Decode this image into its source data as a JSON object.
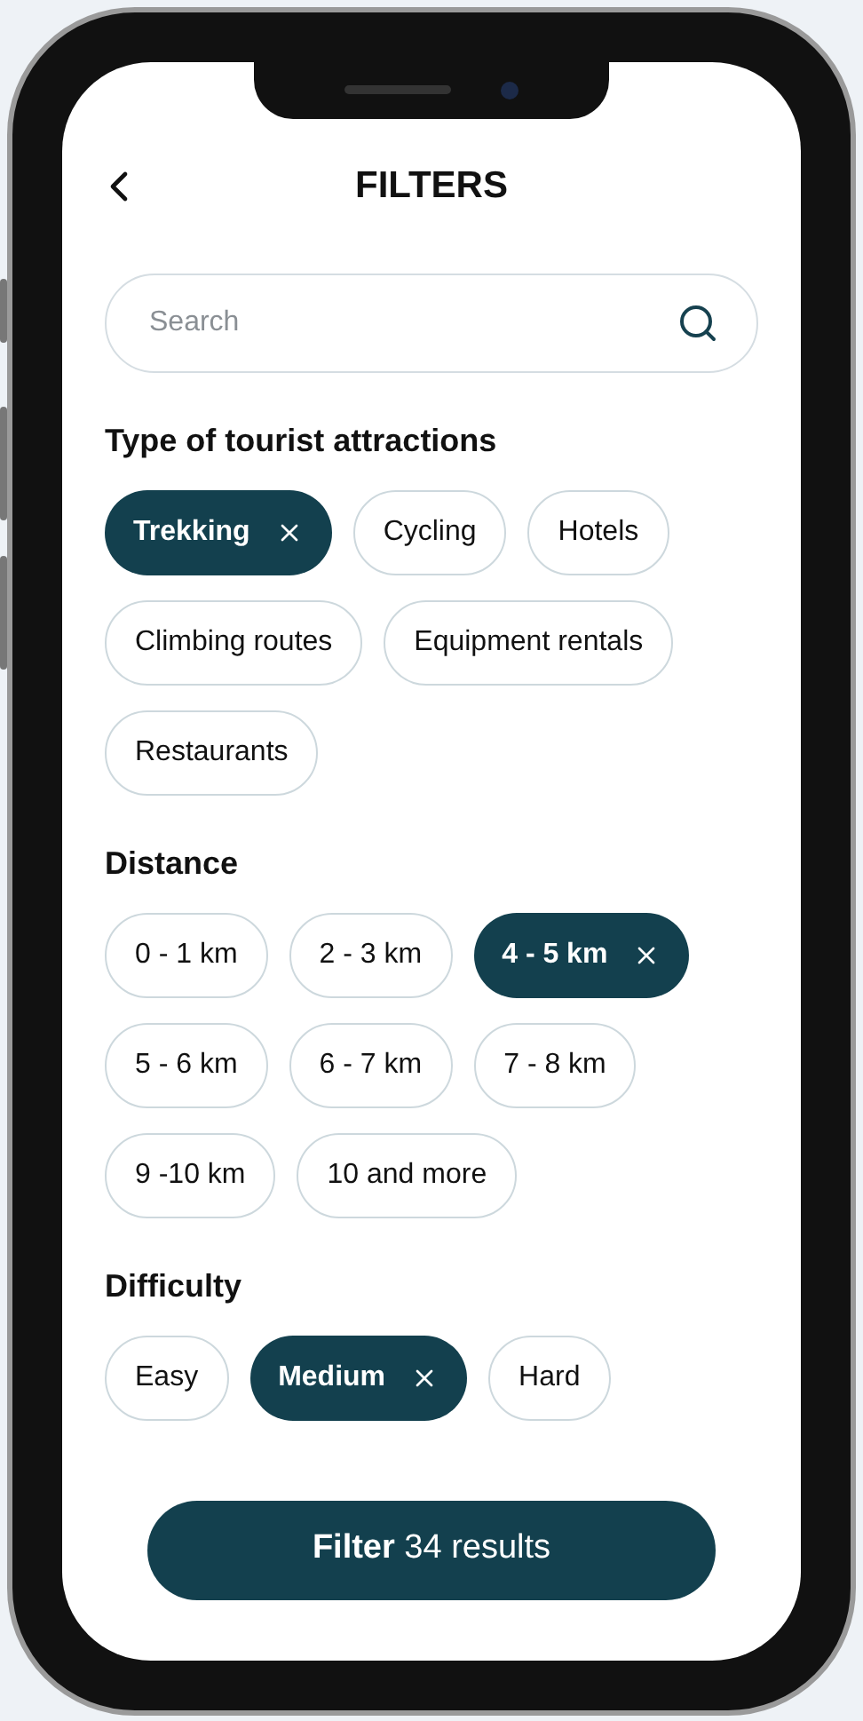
{
  "header": {
    "title": "FILTERS"
  },
  "search": {
    "placeholder": "Search"
  },
  "sections": [
    {
      "heading": "Type of tourist attractions",
      "options": [
        {
          "label": "Trekking",
          "selected": true
        },
        {
          "label": "Cycling",
          "selected": false
        },
        {
          "label": "Hotels",
          "selected": false
        },
        {
          "label": "Climbing routes",
          "selected": false
        },
        {
          "label": "Equipment rentals",
          "selected": false
        },
        {
          "label": "Restaurants",
          "selected": false
        }
      ]
    },
    {
      "heading": "Distance",
      "options": [
        {
          "label": "0 - 1 km",
          "selected": false
        },
        {
          "label": "2 - 3 km",
          "selected": false
        },
        {
          "label": "4 - 5 km",
          "selected": true
        },
        {
          "label": "5 - 6 km",
          "selected": false
        },
        {
          "label": "6 - 7 km",
          "selected": false
        },
        {
          "label": "7 - 8 km",
          "selected": false
        },
        {
          "label": "9 -10 km",
          "selected": false
        },
        {
          "label": "10 and more",
          "selected": false
        }
      ]
    },
    {
      "heading": "Difficulty",
      "options": [
        {
          "label": "Easy",
          "selected": false
        },
        {
          "label": "Medium",
          "selected": true
        },
        {
          "label": "Hard",
          "selected": false
        }
      ]
    }
  ],
  "apply_button": {
    "label": "**Filter** 34 results"
  }
}
